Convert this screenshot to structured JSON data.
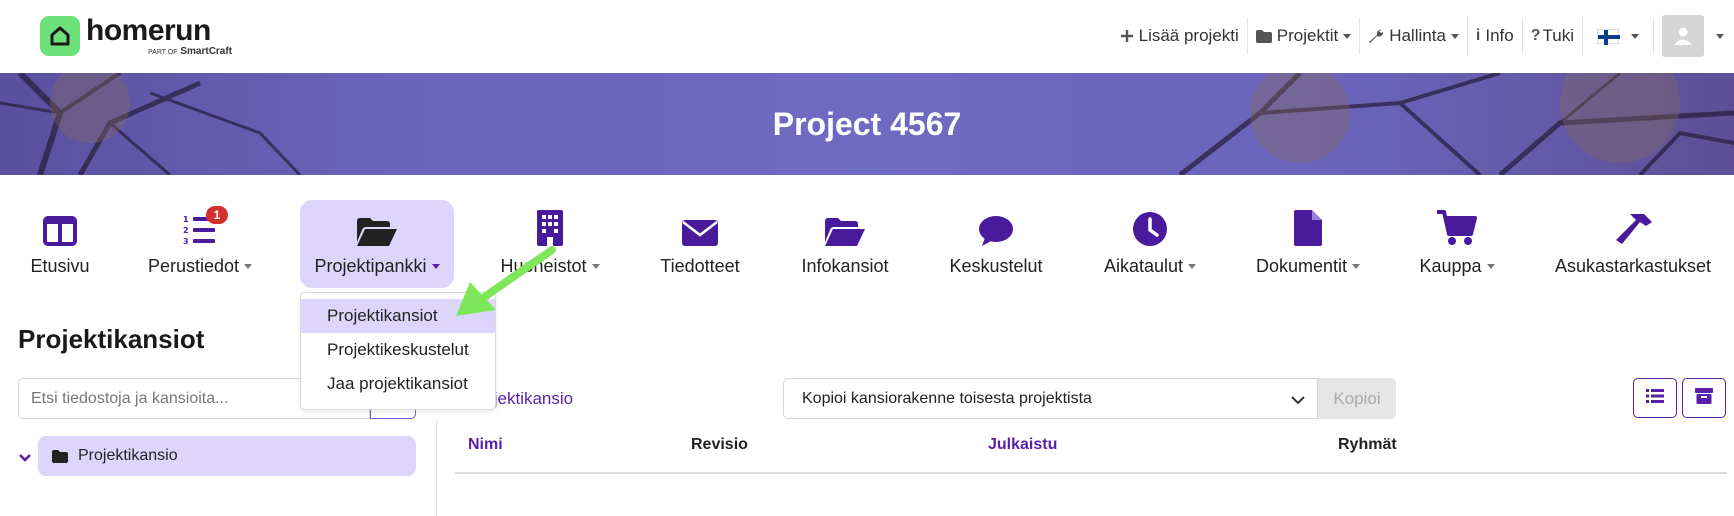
{
  "brand": {
    "name": "homerun",
    "sub_prefix": "PART OF",
    "sub_brand": "SmartCraft",
    "accent": "#6ee07a"
  },
  "topnav": {
    "items": [
      {
        "label": "Lisää projekti",
        "icon": "plus-icon"
      },
      {
        "label": "Projektit",
        "icon": "folder-icon",
        "dropdown": true
      },
      {
        "label": "Hallinta",
        "icon": "wrench-icon",
        "dropdown": true
      },
      {
        "label": "Info",
        "icon": "info-icon"
      },
      {
        "label": "Tuki",
        "icon": "question-icon"
      }
    ],
    "language_flag": "finland-flag-icon",
    "avatar_icon": "user-avatar-icon"
  },
  "banner": {
    "title": "Project 4567"
  },
  "modules": [
    {
      "label": "Etusivu",
      "icon": "columns-icon"
    },
    {
      "label": "Perustiedot",
      "icon": "list-ol-icon",
      "badge": "1",
      "dropdown": true
    },
    {
      "label": "Projektipankki",
      "icon": "folder-open-icon",
      "dropdown": true,
      "active": true
    },
    {
      "label": "Huoneistot",
      "icon": "building-icon",
      "dropdown": true
    },
    {
      "label": "Tiedotteet",
      "icon": "envelope-icon"
    },
    {
      "label": "Infokansiot",
      "icon": "folder-open-icon"
    },
    {
      "label": "Keskustelut",
      "icon": "comment-icon"
    },
    {
      "label": "Aikataulut",
      "icon": "clock-icon",
      "dropdown": true
    },
    {
      "label": "Dokumentit",
      "icon": "file-icon",
      "dropdown": true
    },
    {
      "label": "Kauppa",
      "icon": "cart-icon",
      "dropdown": true
    },
    {
      "label": "Asukastarkastukset",
      "icon": "hammer-icon"
    }
  ],
  "dropdown_menu": {
    "items": [
      {
        "label": "Projektikansiot",
        "active": true
      },
      {
        "label": "Projektikeskustelut"
      },
      {
        "label": "Jaa projektikansiot"
      }
    ]
  },
  "page": {
    "title": "Projektikansiot",
    "search_placeholder": "Etsi tiedostoja ja kansioita...",
    "tree": [
      {
        "label": "Projektikansio",
        "expanded": true
      }
    ],
    "new_folder_link": "o projektikansio",
    "copy_select_value": "Kopioi kansiorakenne toisesta projektista",
    "copy_button": "Kopioi",
    "table_headers": [
      "Nimi",
      "Revisio",
      "Julkaistu",
      "Ryhmät"
    ]
  },
  "colors": {
    "primary": "#5a1fa8",
    "active_bg": "#ddd5fb",
    "arrow": "#7ee85a",
    "badge": "#d32f2f"
  }
}
